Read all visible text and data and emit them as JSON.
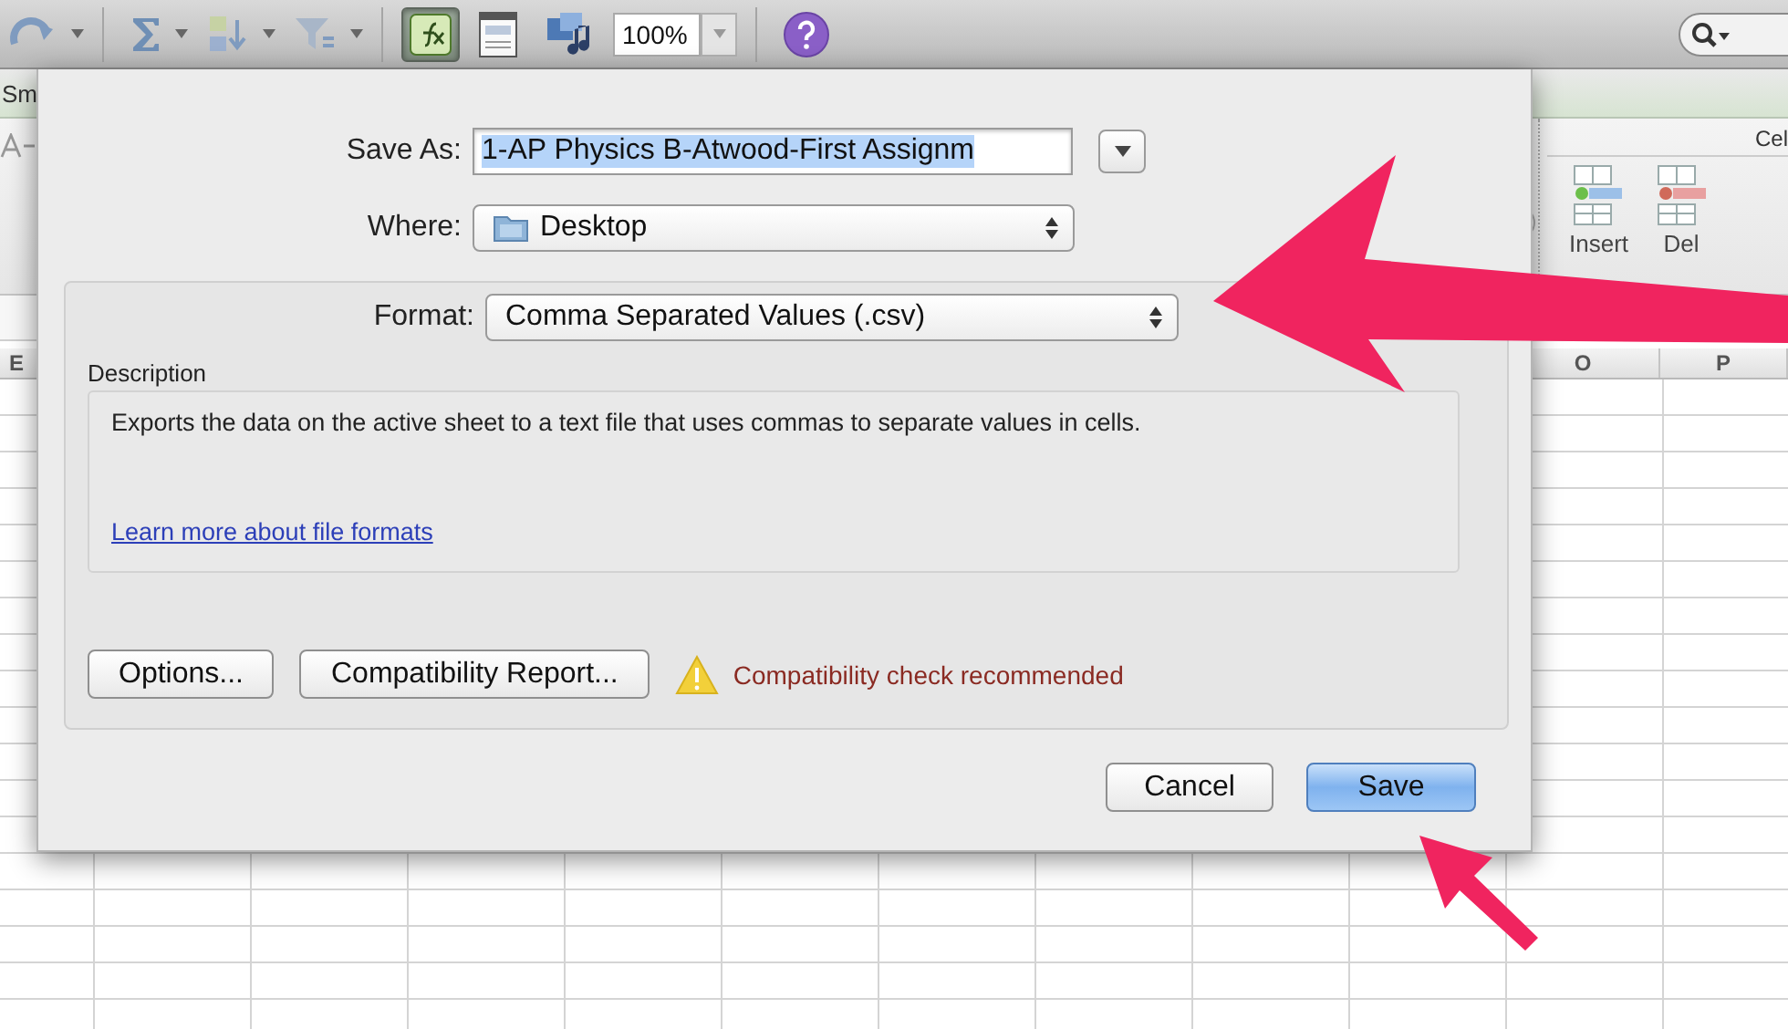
{
  "toolbar": {
    "items": [
      {
        "kind": "redo",
        "has_menu": true,
        "toggled": false
      },
      {
        "kind": "sum",
        "has_menu": true,
        "toggled": false
      },
      {
        "kind": "sort",
        "has_menu": true,
        "toggled": false
      },
      {
        "kind": "filter",
        "has_menu": true,
        "toggled": false
      },
      {
        "kind": "function",
        "has_menu": false,
        "toggled": true
      },
      {
        "kind": "gallery",
        "has_menu": false,
        "toggled": false
      },
      {
        "kind": "media",
        "has_menu": false,
        "toggled": false
      },
      {
        "kind": "zoom",
        "value": "100%"
      },
      {
        "kind": "help",
        "has_menu": false,
        "toggled": false
      }
    ]
  },
  "ribbon": {
    "tab_label": "Sm",
    "group_title": "Cel",
    "buttons": [
      "Insert",
      "Del"
    ]
  },
  "sheet": {
    "columns": [
      "E",
      "O",
      "P"
    ]
  },
  "dialog": {
    "save_as": {
      "label": "Save As:",
      "value": "1-AP Physics B-Atwood-First Assignm",
      "text_selected": true
    },
    "where": {
      "label": "Where:",
      "value": "Desktop"
    },
    "format": {
      "label": "Format:",
      "value": "Comma Separated Values (.csv)"
    },
    "description": {
      "label": "Description",
      "text": "Exports the data on the active sheet to a text file that uses commas to separate values in cells.",
      "link": "Learn more about file formats"
    },
    "buttons": [
      "Options...",
      "Compatibility Report..."
    ],
    "warning": "Compatibility check recommended",
    "actions": [
      {
        "label": "Cancel",
        "default": false
      },
      {
        "label": "Save",
        "default": true
      }
    ]
  }
}
